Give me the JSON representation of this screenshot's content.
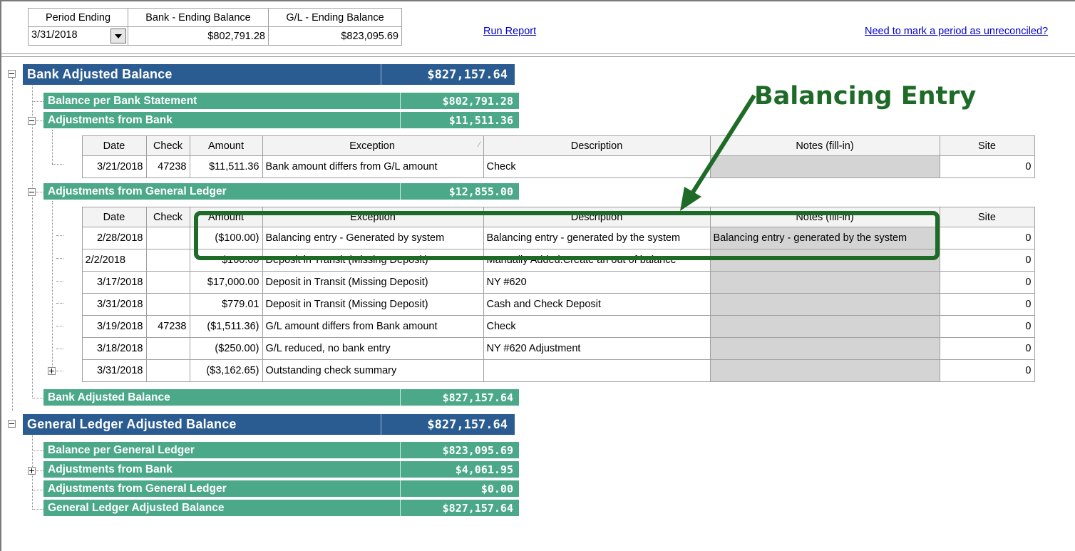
{
  "filters": {
    "period_label": "Period Ending",
    "bank_label": "Bank - Ending Balance",
    "gl_label": "G/L - Ending Balance",
    "period_value": "3/31/2018",
    "bank_value": "$802,791.28",
    "gl_value": "$823,095.69",
    "run_report": "Run Report",
    "unreconciled_link": "Need to mark a period as unreconciled?"
  },
  "bank_section": {
    "title": "Bank Adjusted Balance",
    "amount": "$827,157.64",
    "statement_label": "Balance per Bank Statement",
    "statement_amount": "$802,791.28",
    "adj_bank_label": "Adjustments from Bank",
    "adj_bank_amount": "$11,511.36",
    "adj_gl_label": "Adjustments from General Ledger",
    "adj_gl_amount": "$12,855.00",
    "total_label": "Bank Adjusted Balance",
    "total_amount": "$827,157.64"
  },
  "columns": {
    "date": "Date",
    "check": "Check",
    "amount": "Amount",
    "exception": "Exception",
    "description": "Description",
    "notes": "Notes (fill-in)",
    "site": "Site"
  },
  "bank_rows": [
    {
      "date": "3/21/2018",
      "check": "47238",
      "amount": "$11,511.36",
      "exception": "Bank amount differs from G/L amount",
      "description": "Check",
      "notes": "",
      "site": "0"
    }
  ],
  "gl_rows": [
    {
      "date": "2/28/2018",
      "check": "",
      "amount": "($100.00)",
      "exception": "Balancing entry - Generated by system",
      "description": "Balancing entry - generated by the system",
      "notes": "Balancing entry - generated by the system",
      "site": "0"
    },
    {
      "date": "2/2/2018",
      "check": "",
      "amount": "$100.00",
      "exception": "Deposit in Transit (Missing Deposit)",
      "description": "Manually Added.Create an out of balance",
      "notes": "",
      "site": "0"
    },
    {
      "date": "3/17/2018",
      "check": "",
      "amount": "$17,000.00",
      "exception": "Deposit in Transit (Missing Deposit)",
      "description": "NY #620",
      "notes": "",
      "site": "0"
    },
    {
      "date": "3/31/2018",
      "check": "",
      "amount": "$779.01",
      "exception": "Deposit in Transit (Missing Deposit)",
      "description": "Cash and Check Deposit",
      "notes": "",
      "site": "0"
    },
    {
      "date": "3/19/2018",
      "check": "47238",
      "amount": "($1,511.36)",
      "exception": "G/L amount differs from Bank amount",
      "description": "Check",
      "notes": "",
      "site": "0"
    },
    {
      "date": "3/18/2018",
      "check": "",
      "amount": "($250.00)",
      "exception": "G/L reduced, no bank entry",
      "description": "NY #620 Adjustment",
      "notes": "",
      "site": "0"
    },
    {
      "date": "3/31/2018",
      "check": "",
      "amount": "($3,162.65)",
      "exception": "Outstanding check summary",
      "description": "",
      "notes": "",
      "site": "0"
    }
  ],
  "gl_section": {
    "title": "General Ledger Adjusted Balance",
    "amount": "$827,157.64",
    "per_gl_label": "Balance per General Ledger",
    "per_gl_amount": "$823,095.69",
    "adj_bank_label": "Adjustments from Bank",
    "adj_bank_amount": "$4,061.95",
    "adj_gl_label": "Adjustments from General Ledger",
    "adj_gl_amount": "$0.00",
    "total_label": "General Ledger Adjusted Balance",
    "total_amount": "$827,157.64"
  },
  "annotation": {
    "title": "Balancing Entry",
    "color": "#1e6a27"
  },
  "colors": {
    "header_blue": "#2b5c91",
    "section_green": "#4ba888",
    "link_blue": "#0000cc"
  }
}
